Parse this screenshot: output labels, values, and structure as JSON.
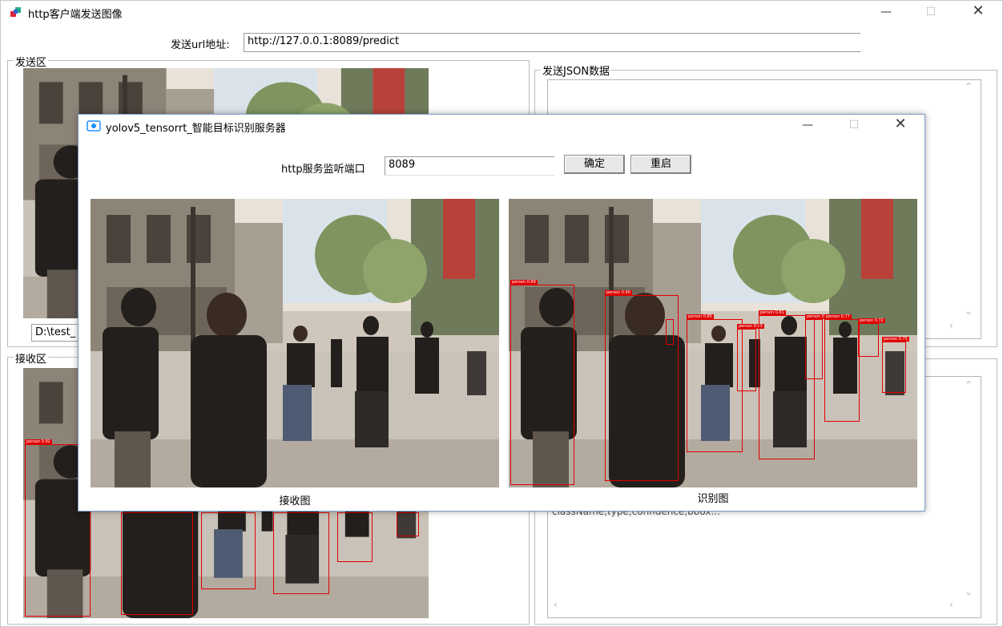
{
  "main_window": {
    "title": "http客户端发送图像",
    "url_label": "发送url地址:",
    "url_value": "http://127.0.0.1:8089/predict",
    "send_group": "发送区",
    "receive_group": "接收区",
    "json_group": "发送JSON数据",
    "file_path": "D:\\test_",
    "json_partial_text": "className,type,confidence,bbox..."
  },
  "server_window": {
    "title": "yolov5_tensorrt_智能目标识别服务器",
    "port_label": "http服务监听端口",
    "port_value": "8089",
    "ok_button": "确定",
    "restart_button": "重启",
    "received_caption": "接收图",
    "recognized_caption": "识别图"
  },
  "detection_labels": [
    "person 0.92",
    "person 0.89",
    "person 0.90",
    "person 0.85",
    "person 0.83",
    "person 0.81",
    "person 0.79",
    "person 0.77",
    "person 0.75",
    "person 0.72"
  ],
  "colors": {
    "detection": "#e00000",
    "accent": "#1e90ff"
  }
}
